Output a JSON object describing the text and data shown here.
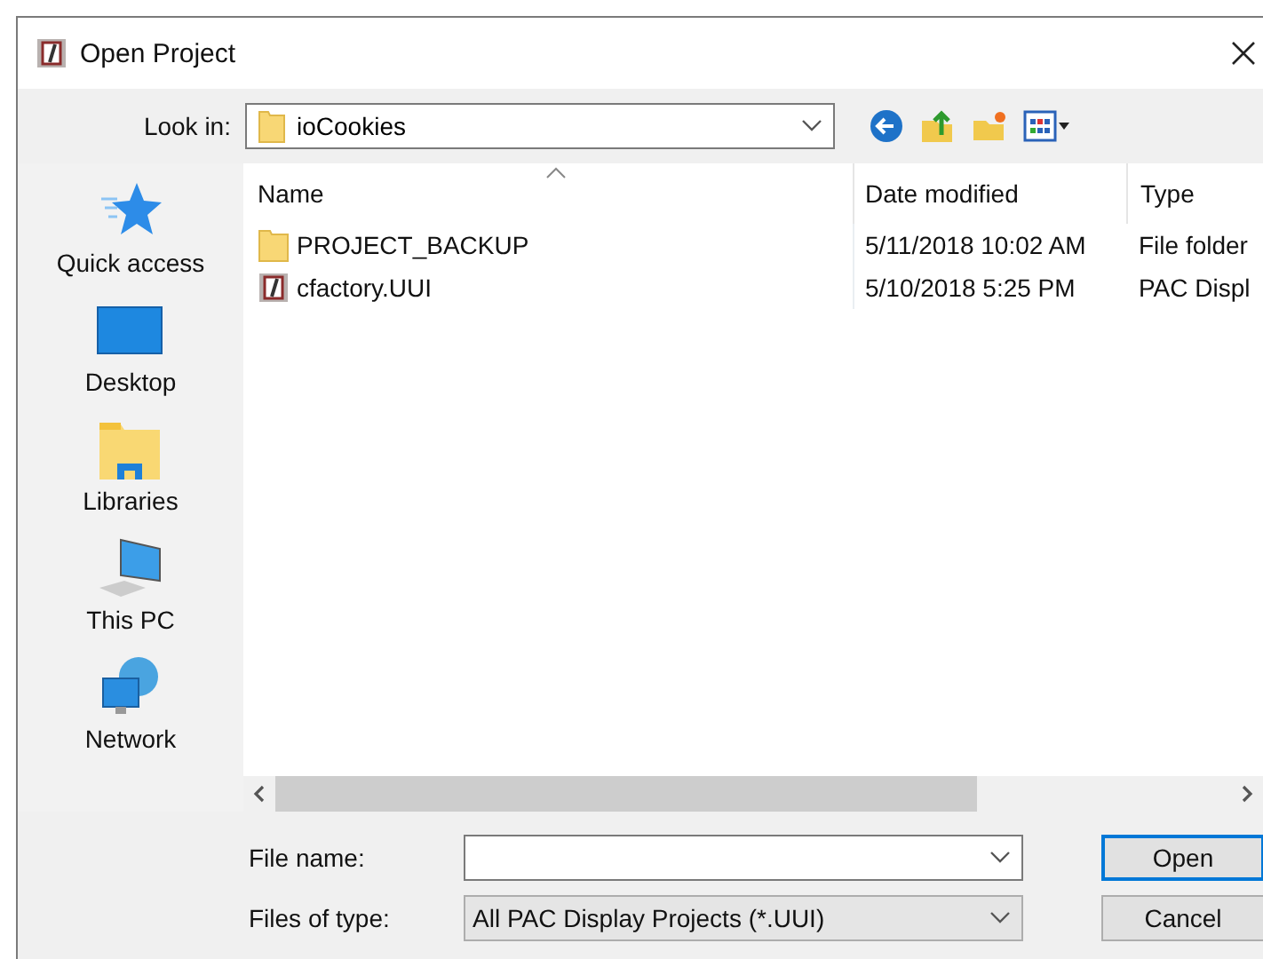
{
  "window": {
    "title": "Open Project"
  },
  "look_in": {
    "label": "Look in:",
    "value": "ioCookies"
  },
  "sidebar": {
    "items": [
      {
        "label": "Quick access",
        "kind": "star"
      },
      {
        "label": "Desktop",
        "kind": "desktop"
      },
      {
        "label": "Libraries",
        "kind": "libraries"
      },
      {
        "label": "This PC",
        "kind": "pc"
      },
      {
        "label": "Network",
        "kind": "network"
      }
    ]
  },
  "table": {
    "columns": [
      "Name",
      "Date modified",
      "Type"
    ],
    "rows": [
      {
        "kind": "folder",
        "name": "PROJECT_BACKUP",
        "date": "5/11/2018 10:02 AM",
        "type": "File folder"
      },
      {
        "kind": "project",
        "name": "cfactory.UUI",
        "date": "5/10/2018 5:25 PM",
        "type": "PAC Displ"
      }
    ]
  },
  "file_name": {
    "label": "File name:"
  },
  "file_type": {
    "label": "Files of type:",
    "value": "All PAC Display Projects (*.UUI)"
  },
  "buttons": [
    "Open",
    "Cancel"
  ]
}
